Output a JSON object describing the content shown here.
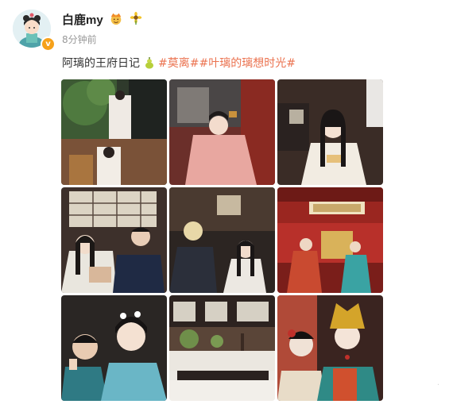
{
  "post": {
    "username": "白鹿my",
    "timestamp": "8分钟前",
    "verified_badge": "v",
    "text_prefix": "阿璃的王府日记",
    "emoji_icon": "gourd-emoji-icon",
    "hashtags": [
      "#莫离#",
      "#叶璃的璃想时光#"
    ],
    "watermark": "·"
  },
  "colors": {
    "hashtag": "#eb7350",
    "badge": "#f6a11a",
    "timestamp": "#999999"
  },
  "photos": [
    {
      "label": "photo-1"
    },
    {
      "label": "photo-2"
    },
    {
      "label": "photo-3"
    },
    {
      "label": "photo-4"
    },
    {
      "label": "photo-5"
    },
    {
      "label": "photo-6"
    },
    {
      "label": "photo-7"
    },
    {
      "label": "photo-8"
    },
    {
      "label": "photo-9"
    }
  ]
}
